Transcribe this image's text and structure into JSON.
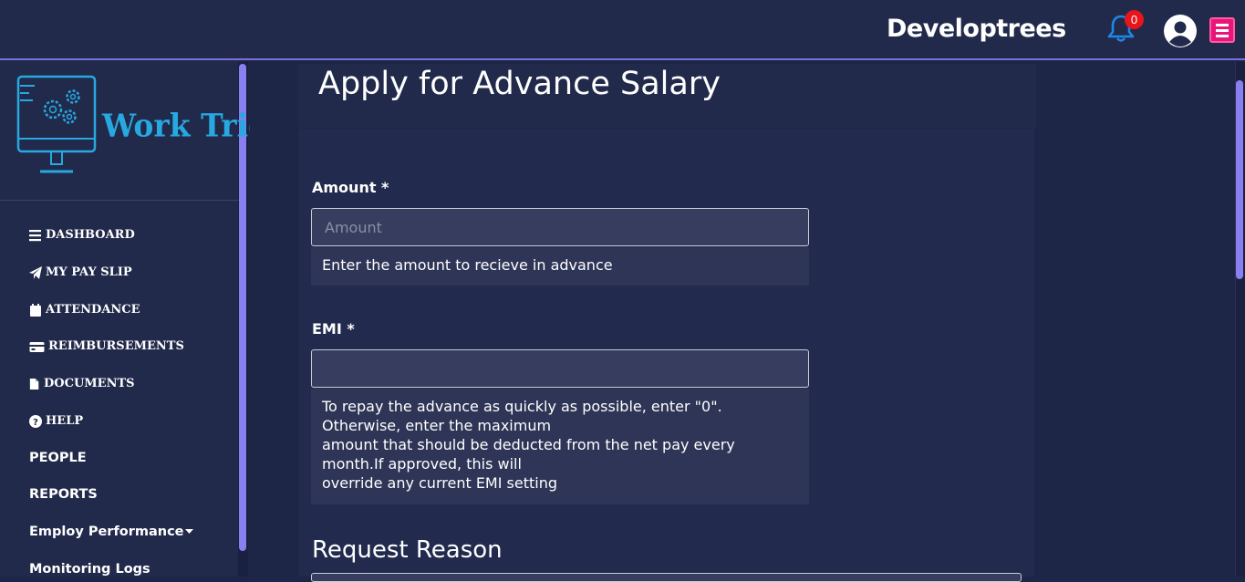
{
  "header": {
    "brand": "Developtrees",
    "notification_count": "0",
    "icons": [
      "bell-icon",
      "user-avatar-icon",
      "hamburger-menu-icon"
    ],
    "colors": {
      "badge": "#e8151b",
      "menu_button": "#e8157a",
      "bell": "#1e88e5"
    }
  },
  "sidebar": {
    "logo_text": "Work Tried",
    "items": [
      {
        "label": "DASHBOARD",
        "icon": "bars-icon"
      },
      {
        "label": "MY PAY SLIP",
        "icon": "paper-plane-icon"
      },
      {
        "label": "ATTENDANCE",
        "icon": "calendar-icon"
      },
      {
        "label": "REIMBURSEMENTS",
        "icon": "credit-card-icon"
      },
      {
        "label": "DOCUMENTS",
        "icon": "file-icon"
      },
      {
        "label": "HELP",
        "icon": "question-circle-icon"
      },
      {
        "label": "PEOPLE"
      },
      {
        "label": "REPORTS"
      },
      {
        "label": "Employ Performance",
        "icon": "caret-down-icon"
      },
      {
        "label": "Monitoring Logs"
      }
    ]
  },
  "main": {
    "title": "Apply for Advance Salary",
    "amount": {
      "label": "Amount *",
      "placeholder": "Amount",
      "value": "",
      "help": "Enter the amount to recieve in advance"
    },
    "emi": {
      "label": "EMI *",
      "value": "",
      "help_lines": [
        "To repay the advance as quickly as possible, enter \"0\".",
        "Otherwise, enter the maximum",
        "amount that should be deducted from the net pay every",
        "month.If approved, this will",
        "override any current EMI setting"
      ]
    },
    "request_reason": {
      "title": "Request Reason"
    }
  }
}
